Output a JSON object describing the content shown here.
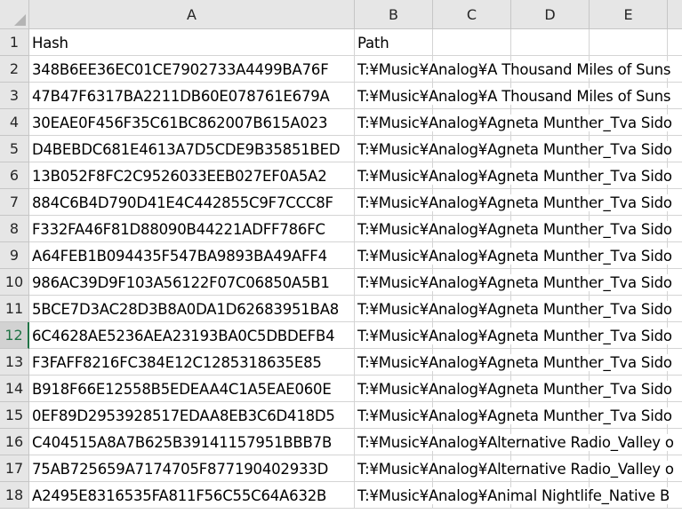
{
  "columns": [
    "A",
    "B",
    "C",
    "D",
    "E"
  ],
  "selected_row": "12",
  "rows": [
    {
      "num": "1",
      "a": "Hash",
      "b": "Path"
    },
    {
      "num": "2",
      "a": "348B6EE36EC01CE7902733A4499BA76F",
      "b": "T:¥Music¥Analog¥A Thousand Miles of Suns"
    },
    {
      "num": "3",
      "a": "47B47F6317BA2211DB60E078761E679A",
      "b": "T:¥Music¥Analog¥A Thousand Miles of Suns"
    },
    {
      "num": "4",
      "a": "30EAE0F456F35C61BC862007B615A023",
      "b": "T:¥Music¥Analog¥Agneta Munther_Tva Sido"
    },
    {
      "num": "5",
      "a": "D4BEBDC681E4613A7D5CDE9B35851BED",
      "b": "T:¥Music¥Analog¥Agneta Munther_Tva Sido"
    },
    {
      "num": "6",
      "a": "13B052F8FC2C9526033EEB027EF0A5A2",
      "b": "T:¥Music¥Analog¥Agneta Munther_Tva Sido"
    },
    {
      "num": "7",
      "a": "884C6B4D790D41E4C442855C9F7CCC8F",
      "b": "T:¥Music¥Analog¥Agneta Munther_Tva Sido"
    },
    {
      "num": "8",
      "a": "F332FA46F81D88090B44221ADFF786FC",
      "b": "T:¥Music¥Analog¥Agneta Munther_Tva Sido"
    },
    {
      "num": "9",
      "a": "A64FEB1B094435F547BA9893BA49AFF4",
      "b": "T:¥Music¥Analog¥Agneta Munther_Tva Sido"
    },
    {
      "num": "10",
      "a": "986AC39D9F103A56122F07C06850A5B1",
      "b": "T:¥Music¥Analog¥Agneta Munther_Tva Sido"
    },
    {
      "num": "11",
      "a": "5BCE7D3AC28D3B8A0DA1D62683951BA8",
      "b": "T:¥Music¥Analog¥Agneta Munther_Tva Sido"
    },
    {
      "num": "12",
      "a": "6C4628AE5236AEA23193BA0C5DBDEFB4",
      "b": "T:¥Music¥Analog¥Agneta Munther_Tva Sido"
    },
    {
      "num": "13",
      "a": "F3FAFF8216FC384E12C1285318635E85",
      "b": "T:¥Music¥Analog¥Agneta Munther_Tva Sido"
    },
    {
      "num": "14",
      "a": "B918F66E12558B5EDEAA4C1A5EAE060E",
      "b": "T:¥Music¥Analog¥Agneta Munther_Tva Sido"
    },
    {
      "num": "15",
      "a": "0EF89D2953928517EDAA8EB3C6D418D5",
      "b": "T:¥Music¥Analog¥Agneta Munther_Tva Sido"
    },
    {
      "num": "16",
      "a": "C404515A8A7B625B39141157951BBB7B",
      "b": "T:¥Music¥Analog¥Alternative Radio_Valley o"
    },
    {
      "num": "17",
      "a": "75AB725659A7174705F877190402933D",
      "b": "T:¥Music¥Analog¥Alternative Radio_Valley o"
    },
    {
      "num": "18",
      "a": "A2495E8316535FA811F56C55C64A632B",
      "b": "T:¥Music¥Analog¥Animal Nightlife_Native B"
    }
  ]
}
